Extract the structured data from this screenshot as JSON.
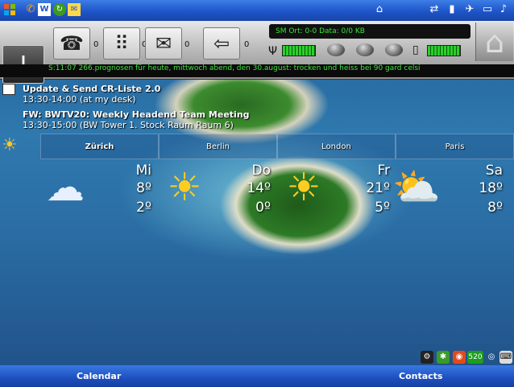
{
  "status_bar": {
    "icons": [
      "windows-start-icon",
      "phone-icon",
      "word-icon",
      "refresh-icon",
      "messenger-icon"
    ],
    "right_icons": [
      "home-icon",
      "sync-icon",
      "signal-icon",
      "battery-icon"
    ]
  },
  "toolbar": {
    "status_text": "SM   Ort: 0-0   Data: 0/0 KB",
    "counts": [
      "0",
      "0",
      "0",
      "0"
    ],
    "ticker": "S:11:07 266.prognosen für heute, mittwoch abend, den 30.august: trocken und heiss bei 90 gard celsi"
  },
  "appointments": [
    {
      "title": "Update & Send CR-Liste 2.0",
      "time": "13:30-14:00 (at my desk)"
    },
    {
      "title": "FW: BWTV20: Weekly Headend Team Meeting",
      "time": "13:30-15:00 (BW Tower 1. Stock Raum Raum 6)"
    }
  ],
  "weather": {
    "cities": [
      "Zürich",
      "Berlin",
      "London",
      "Paris"
    ],
    "active_city": "Zürich",
    "days": [
      {
        "name": "Mi",
        "high": "8º",
        "low": "2º",
        "icon": "rain-cloud-icon"
      },
      {
        "name": "Do",
        "high": "14º",
        "low": "0º",
        "icon": "sun-icon"
      },
      {
        "name": "Fr",
        "high": "21º",
        "low": "5º",
        "icon": "sun-icon"
      },
      {
        "name": "Sa",
        "high": "18º",
        "low": "8º",
        "icon": "partly-cloudy-icon"
      }
    ]
  },
  "tray": {
    "badge": "520"
  },
  "softkeys": {
    "left": "Calendar",
    "right": "Contacts"
  },
  "colors": {
    "accent": "#1f55c8",
    "ticker": "#3fe23f"
  }
}
